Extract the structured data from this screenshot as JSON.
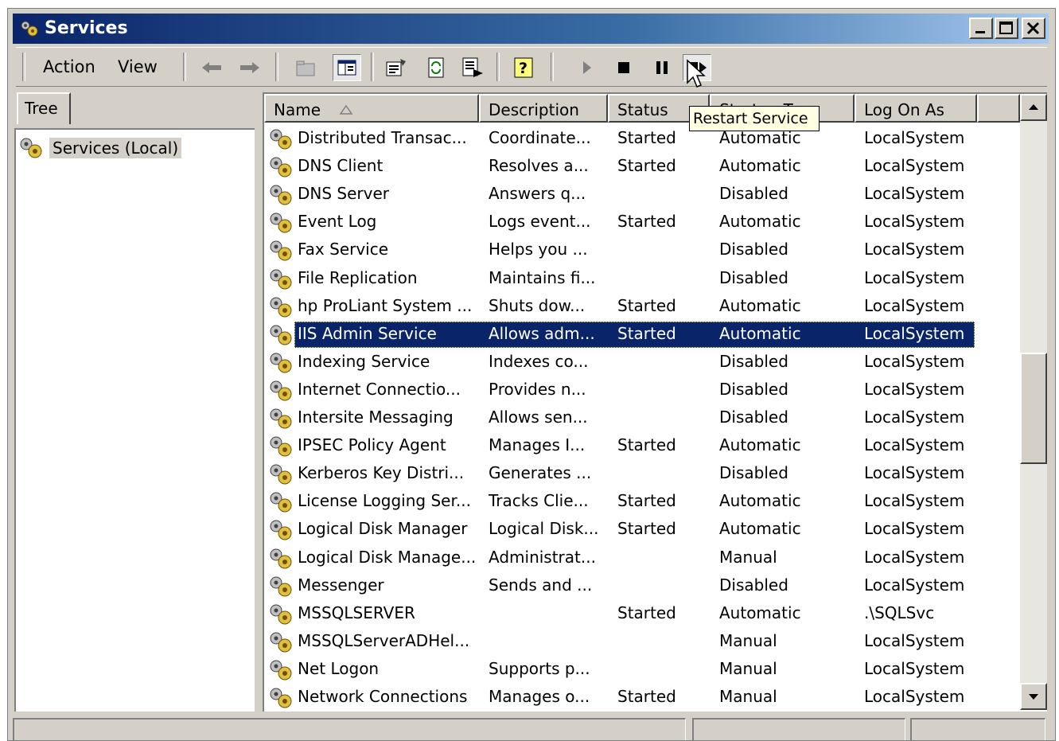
{
  "window": {
    "title": "Services"
  },
  "menu": {
    "action": "Action",
    "view": "View"
  },
  "icons": {
    "title": "services-gear-icon",
    "row": "service-gear-icon",
    "tree": "services-gear-icon"
  },
  "tree": {
    "tab_label": "Tree",
    "root_label": "Services (Local)"
  },
  "columns": {
    "name": "Name",
    "description": "Description",
    "status": "Status",
    "startup": "Startup Type",
    "logon": "Log On As"
  },
  "tooltip": "Restart Service",
  "rows": [
    {
      "name": "Distributed Transac...",
      "description": "Coordinate...",
      "status": "Started",
      "startup": "Automatic",
      "logon": "LocalSystem"
    },
    {
      "name": "DNS Client",
      "description": "Resolves a...",
      "status": "Started",
      "startup": "Automatic",
      "logon": "LocalSystem"
    },
    {
      "name": "DNS Server",
      "description": "Answers q...",
      "status": "",
      "startup": "Disabled",
      "logon": "LocalSystem"
    },
    {
      "name": "Event Log",
      "description": "Logs event...",
      "status": "Started",
      "startup": "Automatic",
      "logon": "LocalSystem"
    },
    {
      "name": "Fax Service",
      "description": "Helps you ...",
      "status": "",
      "startup": "Disabled",
      "logon": "LocalSystem"
    },
    {
      "name": "File Replication",
      "description": "Maintains fi...",
      "status": "",
      "startup": "Disabled",
      "logon": "LocalSystem"
    },
    {
      "name": "hp ProLiant System ...",
      "description": "Shuts dow...",
      "status": "Started",
      "startup": "Automatic",
      "logon": "LocalSystem"
    },
    {
      "name": "IIS Admin Service",
      "description": "Allows adm...",
      "status": "Started",
      "startup": "Automatic",
      "logon": "LocalSystem",
      "selected": true
    },
    {
      "name": "Indexing Service",
      "description": "Indexes co...",
      "status": "",
      "startup": "Disabled",
      "logon": "LocalSystem"
    },
    {
      "name": "Internet Connectio...",
      "description": "Provides n...",
      "status": "",
      "startup": "Disabled",
      "logon": "LocalSystem"
    },
    {
      "name": "Intersite Messaging",
      "description": "Allows sen...",
      "status": "",
      "startup": "Disabled",
      "logon": "LocalSystem"
    },
    {
      "name": "IPSEC Policy Agent",
      "description": "Manages I...",
      "status": "Started",
      "startup": "Automatic",
      "logon": "LocalSystem"
    },
    {
      "name": "Kerberos Key Distri...",
      "description": "Generates ...",
      "status": "",
      "startup": "Disabled",
      "logon": "LocalSystem"
    },
    {
      "name": "License Logging Ser...",
      "description": "Tracks Clie...",
      "status": "Started",
      "startup": "Automatic",
      "logon": "LocalSystem"
    },
    {
      "name": "Logical Disk Manager",
      "description": "Logical Disk...",
      "status": "Started",
      "startup": "Automatic",
      "logon": "LocalSystem"
    },
    {
      "name": "Logical Disk Manage...",
      "description": "Administrat...",
      "status": "",
      "startup": "Manual",
      "logon": "LocalSystem"
    },
    {
      "name": "Messenger",
      "description": "Sends and ...",
      "status": "",
      "startup": "Disabled",
      "logon": "LocalSystem"
    },
    {
      "name": "MSSQLSERVER",
      "description": "",
      "status": "Started",
      "startup": "Automatic",
      "logon": ".\\SQLSvc"
    },
    {
      "name": "MSSQLServerADHel...",
      "description": "",
      "status": "",
      "startup": "Manual",
      "logon": "LocalSystem"
    },
    {
      "name": "Net Logon",
      "description": "Supports p...",
      "status": "",
      "startup": "Manual",
      "logon": "LocalSystem"
    },
    {
      "name": "Network Connections",
      "description": "Manages o...",
      "status": "Started",
      "startup": "Manual",
      "logon": "LocalSystem"
    }
  ],
  "colors": {
    "selection": "#0a246a",
    "chrome": "#d4d0c8",
    "tooltip_bg": "#ffffe1"
  }
}
